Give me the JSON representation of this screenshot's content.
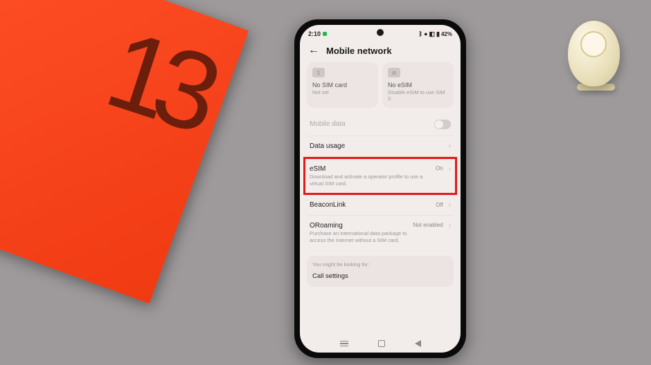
{
  "statusbar": {
    "time": "2:10",
    "battery": "42%"
  },
  "header": {
    "title": "Mobile network"
  },
  "sim_cards": [
    {
      "icon": "1",
      "title": "No SIM card",
      "subtitle": "Not set"
    },
    {
      "icon": "⊘",
      "title": "No eSIM",
      "subtitle": "Disable eSIM to use SIM 2."
    }
  ],
  "rows": {
    "mobile_data": {
      "title": "Mobile data"
    },
    "data_usage": {
      "title": "Data usage"
    },
    "esim": {
      "title": "eSIM",
      "subtitle": "Download and activate a operator profile to use a virtual SIM card.",
      "value": "On"
    },
    "beaconlink": {
      "title": "BeaconLink",
      "value": "Off"
    },
    "oroaming": {
      "title": "ORoaming",
      "subtitle": "Purchase an international data package to access the Internet without a SIM card.",
      "value": "Not enabled"
    }
  },
  "footer": {
    "hint": "You might be looking for:",
    "link": "Call settings"
  }
}
